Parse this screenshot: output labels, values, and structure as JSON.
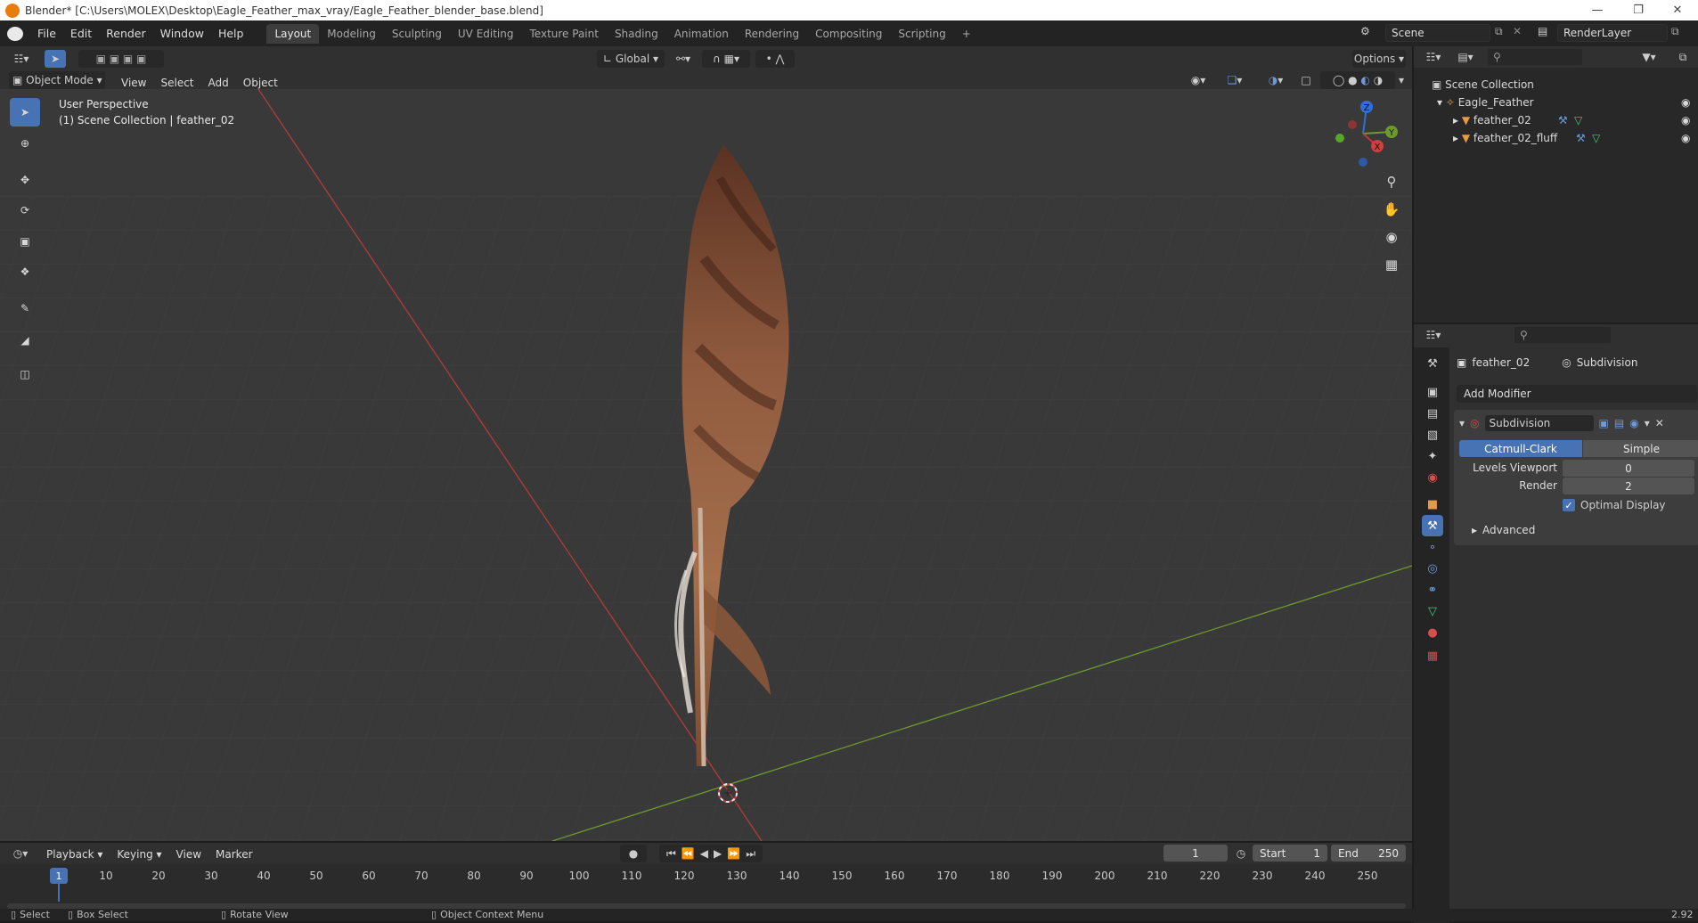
{
  "titlebar": {
    "title": "Blender* [C:\\Users\\MOLEX\\Desktop\\Eagle_Feather_max_vray/Eagle_Feather_blender_base.blend]"
  },
  "menu": [
    "File",
    "Edit",
    "Render",
    "Window",
    "Help"
  ],
  "workspaces": [
    "Layout",
    "Modeling",
    "Sculpting",
    "UV Editing",
    "Texture Paint",
    "Shading",
    "Animation",
    "Rendering",
    "Compositing",
    "Scripting"
  ],
  "scene": {
    "name": "Scene",
    "render_layer": "RenderLayer"
  },
  "viewport": {
    "transform_orientation": "Global",
    "options_label": "Options",
    "mode": "Object Mode",
    "header_menus": [
      "View",
      "Select",
      "Add",
      "Object"
    ],
    "overlay_line1": "User Perspective",
    "overlay_line2": "(1) Scene Collection | feather_02"
  },
  "axes": {
    "x": "X",
    "y": "Y",
    "z": "Z"
  },
  "outliner": {
    "root": "Scene Collection",
    "collection": "Eagle_Feather",
    "objects": [
      "feather_02",
      "feather_02_fluff"
    ]
  },
  "properties": {
    "object_name": "feather_02",
    "modifier_context": "Subdivision",
    "add_modifier": "Add Modifier",
    "modifier_name": "Subdivision",
    "mode_catmull": "Catmull-Clark",
    "mode_simple": "Simple",
    "levels_viewport_label": "Levels Viewport",
    "levels_viewport_value": "0",
    "render_label": "Render",
    "render_value": "2",
    "optimal_display": "Optimal Display",
    "advanced": "Advanced"
  },
  "timeline": {
    "menus": [
      "Playback",
      "Keying",
      "View",
      "Marker"
    ],
    "current_frame": "1",
    "start_label": "Start",
    "start_value": "1",
    "end_label": "End",
    "end_value": "250",
    "ticks": [
      "1",
      "10",
      "20",
      "30",
      "40",
      "50",
      "60",
      "70",
      "80",
      "90",
      "100",
      "110",
      "120",
      "130",
      "140",
      "150",
      "160",
      "170",
      "180",
      "190",
      "200",
      "210",
      "220",
      "230",
      "240",
      "250"
    ]
  },
  "statusbar": {
    "select": "Select",
    "box_select": "Box Select",
    "rotate_view": "Rotate View",
    "context_menu": "Object Context Menu",
    "version": "2.92"
  },
  "colors": {
    "accent": "#4772b3",
    "x_axis": "#b53a3a",
    "y_axis": "#6c9a2e",
    "z_axis": "#2f6fd6",
    "grid_bg": "#393939"
  }
}
